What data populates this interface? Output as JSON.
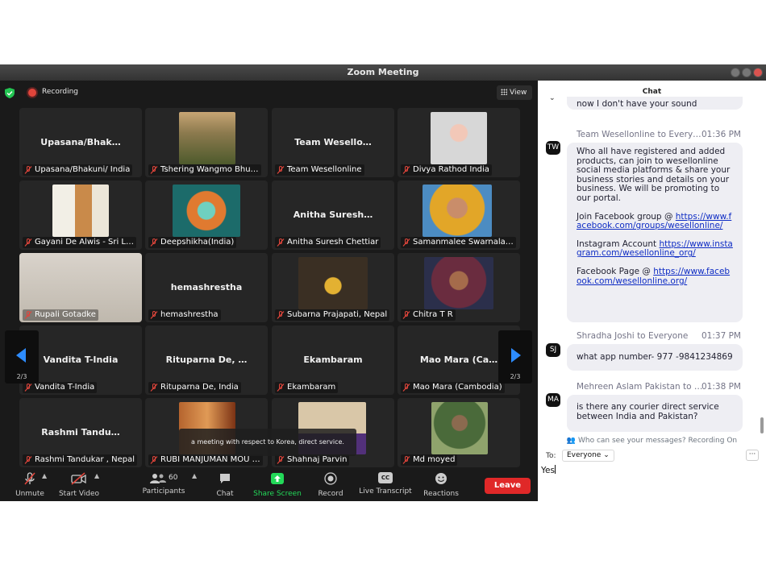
{
  "window": {
    "title": "Zoom Meeting"
  },
  "topbar": {
    "recording_label": "Recording",
    "view_label": "View"
  },
  "tiles": [
    {
      "name": "Upasana/Bhak…",
      "label": "Upasana/Bhakuni/ India",
      "video": false
    },
    {
      "name": "",
      "label": "Tshering Wangmo Bhu…",
      "video": true,
      "photo": "field-photo"
    },
    {
      "name": "Team Wesello…",
      "label": "Team Wesellonline",
      "video": false
    },
    {
      "name": "",
      "label": "Divya Rathod India",
      "video": true,
      "photo": "profile-photo"
    },
    {
      "name": "",
      "label": "Gayani De Alwis - Sri L…",
      "video": true,
      "photo": "profile-photo"
    },
    {
      "name": "",
      "label": "Deepshikha(India)",
      "video": true,
      "photo": "art-photo"
    },
    {
      "name": "Anitha Suresh…",
      "label": "Anitha Suresh Chettiar",
      "video": false
    },
    {
      "name": "",
      "label": "Samanmalee Swarnala…",
      "video": true,
      "photo": "profile-photo"
    },
    {
      "name": "",
      "label": "Rupali Gotadke",
      "video": true,
      "photo": "video-feed"
    },
    {
      "name": "hemashrestha",
      "label": "hemashrestha",
      "video": false
    },
    {
      "name": "",
      "label": "Subarna Prajapati, Nepal",
      "video": true,
      "photo": "video-feed"
    },
    {
      "name": "",
      "label": "Chitra T R",
      "video": true,
      "photo": "video-feed"
    },
    {
      "name": "Vandita T-India",
      "label": "Vandita T-India",
      "video": false
    },
    {
      "name": "Rituparna De, …",
      "label": "Rituparna De, India",
      "video": false
    },
    {
      "name": "Ekambaram",
      "label": "Ekambaram",
      "video": false
    },
    {
      "name": "Mao Mara (Ca…",
      "label": "Mao Mara (Cambodia)",
      "video": false
    },
    {
      "name": "Rashmi Tandu…",
      "label": "Rashmi Tandukar , Nepal",
      "video": false
    },
    {
      "name": "",
      "label": "RUBI MANJUMAN MOU …",
      "video": true,
      "photo": "art-photo"
    },
    {
      "name": "",
      "label": "Shahnaj Parvin",
      "video": true,
      "photo": "profile-photo"
    },
    {
      "name": "",
      "label": "Md moyed",
      "video": true,
      "photo": "profile-photo"
    }
  ],
  "pager": {
    "left": "2/3",
    "right": "2/3"
  },
  "caption": "a meeting with respect to Korea, direct service.",
  "toolbar": {
    "unmute": "Unmute",
    "start_video": "Start Video",
    "participants": "Participants",
    "participants_count": "60",
    "chat": "Chat",
    "share_screen": "Share Screen",
    "record": "Record",
    "live_transcript": "Live Transcript",
    "transcript_icon_text": "CC",
    "reactions": "Reactions",
    "leave": "Leave"
  },
  "chat": {
    "title": "Chat",
    "prev_tail": "now I don't have your sound",
    "messages": [
      {
        "avatar": "TW",
        "sender": "Team Wesellonline to Every…",
        "time": "01:36 PM",
        "p1": "Who all have registered and added products, can join to wesellonline social media platforms & share your business stories and details on your business. We will be promoting to our portal.",
        "fb_group_prefix": "Join Facebook group @ ",
        "fb_group_link": "https://www.facebook.com/groups/wesellonline/",
        "ig_prefix": "Instagram Account ",
        "ig_link": "https://www.instagram.com/wesellonline_org/",
        "fb_page_prefix": "Facebook Page @ ",
        "fb_page_link": "https://www.facebook.com/wesellonline.org/"
      },
      {
        "avatar": "SJ",
        "sender": "Shradha Joshi to Everyone",
        "time": "01:37 PM",
        "text": "what app number- 977 -9841234869"
      },
      {
        "avatar": "MA",
        "sender": "Mehreen Aslam Pakistan to …",
        "time": "01:38 PM",
        "text": "is there any courier direct service between India and Pakistan?"
      }
    ],
    "privacy_note": "Who can see your messages? Recording On",
    "to_label": "To:",
    "to_value": "Everyone",
    "more_label": "···",
    "input_value": "Yes"
  },
  "colors": {
    "share_green": "#23d959",
    "leave_red": "#e02828",
    "link_blue": "#0e2cc4",
    "mute_red": "#e0453b"
  }
}
